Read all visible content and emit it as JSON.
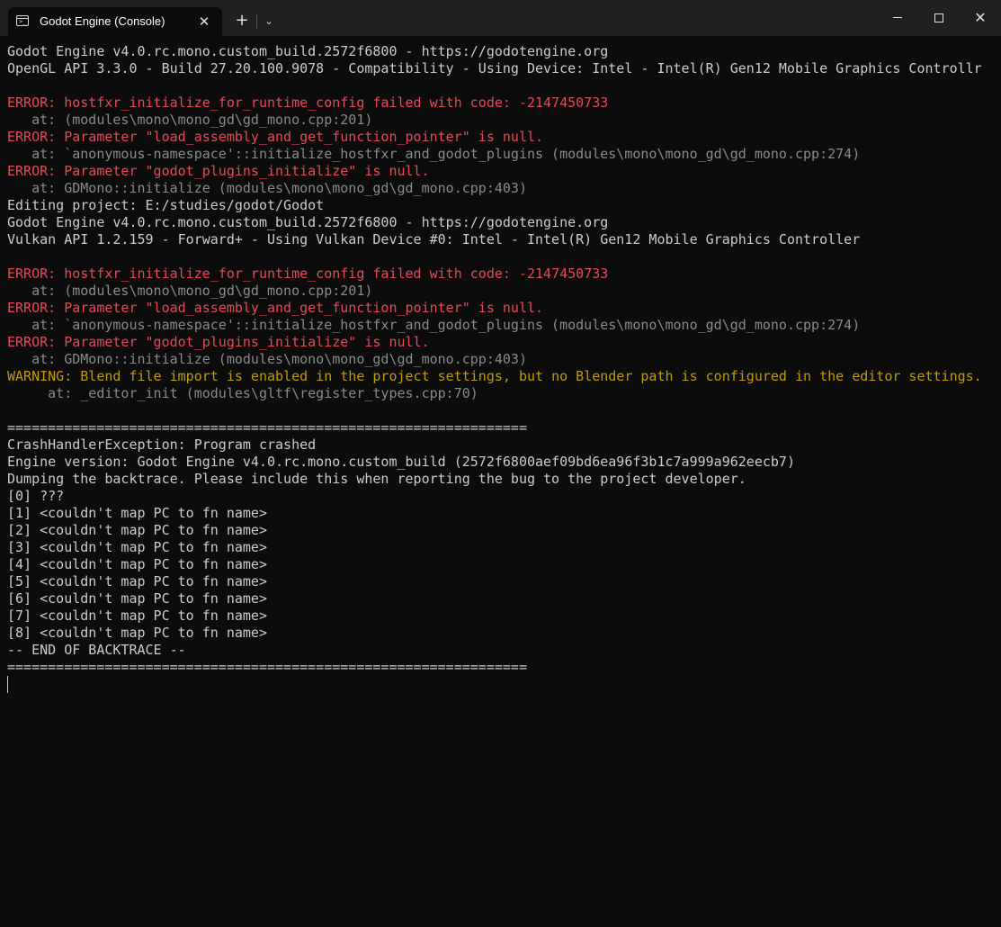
{
  "tab": {
    "title": "Godot Engine (Console)",
    "icon": "terminal-icon",
    "icon_glyph": ">_",
    "close_symbol": "✕"
  },
  "titlebar": {
    "new_tab_symbol": "+",
    "dropdown_symbol": "⌄",
    "close_symbol": "✕"
  },
  "colors": {
    "background": "#0c0c0c",
    "titlebar": "#202020",
    "default_text": "#cccccc",
    "error": "#e74856",
    "warning": "#c19c00",
    "at_text": "#8a8a8a"
  },
  "console": {
    "lines": [
      {
        "segments": [
          {
            "text": "Godot Engine v4.0.rc.mono.custom_build.2572f6800 - https://godotengine.org",
            "style": "default"
          }
        ]
      },
      {
        "segments": [
          {
            "text": "OpenGL API 3.3.0 - Build 27.20.100.9078 - Compatibility - Using Device: Intel - Intel(R) Gen12 Mobile Graphics Controllr",
            "style": "default"
          }
        ]
      },
      {
        "segments": []
      },
      {
        "segments": [
          {
            "text": "ERROR: ",
            "style": "err"
          },
          {
            "text": "hostfxr_initialize_for_runtime_config failed with code: -2147450733",
            "style": "err"
          }
        ]
      },
      {
        "segments": [
          {
            "text": "   at: (modules\\mono\\mono_gd\\gd_mono.cpp:201)",
            "style": "at"
          }
        ]
      },
      {
        "segments": [
          {
            "text": "ERROR: ",
            "style": "err"
          },
          {
            "text": "Parameter \"load_assembly_and_get_function_pointer\" is null.",
            "style": "err"
          }
        ]
      },
      {
        "segments": [
          {
            "text": "   at: `anonymous-namespace'::initialize_hostfxr_and_godot_plugins (modules\\mono\\mono_gd\\gd_mono.cpp:274)",
            "style": "at"
          }
        ]
      },
      {
        "segments": [
          {
            "text": "ERROR: ",
            "style": "err"
          },
          {
            "text": "Parameter \"godot_plugins_initialize\" is null.",
            "style": "err"
          }
        ]
      },
      {
        "segments": [
          {
            "text": "   at: GDMono::initialize (modules\\mono\\mono_gd\\gd_mono.cpp:403)",
            "style": "at"
          }
        ]
      },
      {
        "segments": [
          {
            "text": "Editing project: E:/studies/godot/Godot",
            "style": "default"
          }
        ]
      },
      {
        "segments": [
          {
            "text": "Godot Engine v4.0.rc.mono.custom_build.2572f6800 - https://godotengine.org",
            "style": "default"
          }
        ]
      },
      {
        "segments": [
          {
            "text": "Vulkan API 1.2.159 - Forward+ - Using Vulkan Device #0: Intel - Intel(R) Gen12 Mobile Graphics Controller",
            "style": "default"
          }
        ]
      },
      {
        "segments": []
      },
      {
        "segments": [
          {
            "text": "ERROR: ",
            "style": "err"
          },
          {
            "text": "hostfxr_initialize_for_runtime_config failed with code: -2147450733",
            "style": "err"
          }
        ]
      },
      {
        "segments": [
          {
            "text": "   at: (modules\\mono\\mono_gd\\gd_mono.cpp:201)",
            "style": "at"
          }
        ]
      },
      {
        "segments": [
          {
            "text": "ERROR: ",
            "style": "err"
          },
          {
            "text": "Parameter \"load_assembly_and_get_function_pointer\" is null.",
            "style": "err"
          }
        ]
      },
      {
        "segments": [
          {
            "text": "   at: `anonymous-namespace'::initialize_hostfxr_and_godot_plugins (modules\\mono\\mono_gd\\gd_mono.cpp:274)",
            "style": "at"
          }
        ]
      },
      {
        "segments": [
          {
            "text": "ERROR: ",
            "style": "err"
          },
          {
            "text": "Parameter \"godot_plugins_initialize\" is null.",
            "style": "err"
          }
        ]
      },
      {
        "segments": [
          {
            "text": "   at: GDMono::initialize (modules\\mono\\mono_gd\\gd_mono.cpp:403)",
            "style": "at"
          }
        ]
      },
      {
        "segments": [
          {
            "text": "WARNING: ",
            "style": "warn"
          },
          {
            "text": "Blend file import is enabled in the project settings, but no Blender path is configured in the editor settings.",
            "style": "warn"
          }
        ]
      },
      {
        "segments": [
          {
            "text": "     at: _editor_init (modules\\gltf\\register_types.cpp:70)",
            "style": "at"
          }
        ]
      },
      {
        "segments": []
      },
      {
        "segments": [
          {
            "text": "================================================================",
            "style": "default"
          }
        ]
      },
      {
        "segments": [
          {
            "text": "CrashHandlerException: Program crashed",
            "style": "default"
          }
        ]
      },
      {
        "segments": [
          {
            "text": "Engine version: Godot Engine v4.0.rc.mono.custom_build (2572f6800aef09bd6ea96f3b1c7a999a962eecb7)",
            "style": "default"
          }
        ]
      },
      {
        "segments": [
          {
            "text": "Dumping the backtrace. Please include this when reporting the bug to the project developer.",
            "style": "default"
          }
        ]
      },
      {
        "segments": [
          {
            "text": "[0] ???",
            "style": "default"
          }
        ]
      },
      {
        "segments": [
          {
            "text": "[1] <couldn't map PC to fn name>",
            "style": "default"
          }
        ]
      },
      {
        "segments": [
          {
            "text": "[2] <couldn't map PC to fn name>",
            "style": "default"
          }
        ]
      },
      {
        "segments": [
          {
            "text": "[3] <couldn't map PC to fn name>",
            "style": "default"
          }
        ]
      },
      {
        "segments": [
          {
            "text": "[4] <couldn't map PC to fn name>",
            "style": "default"
          }
        ]
      },
      {
        "segments": [
          {
            "text": "[5] <couldn't map PC to fn name>",
            "style": "default"
          }
        ]
      },
      {
        "segments": [
          {
            "text": "[6] <couldn't map PC to fn name>",
            "style": "default"
          }
        ]
      },
      {
        "segments": [
          {
            "text": "[7] <couldn't map PC to fn name>",
            "style": "default"
          }
        ]
      },
      {
        "segments": [
          {
            "text": "[8] <couldn't map PC to fn name>",
            "style": "default"
          }
        ]
      },
      {
        "segments": [
          {
            "text": "-- END OF BACKTRACE --",
            "style": "default"
          }
        ]
      },
      {
        "segments": [
          {
            "text": "================================================================",
            "style": "default"
          }
        ]
      }
    ]
  }
}
